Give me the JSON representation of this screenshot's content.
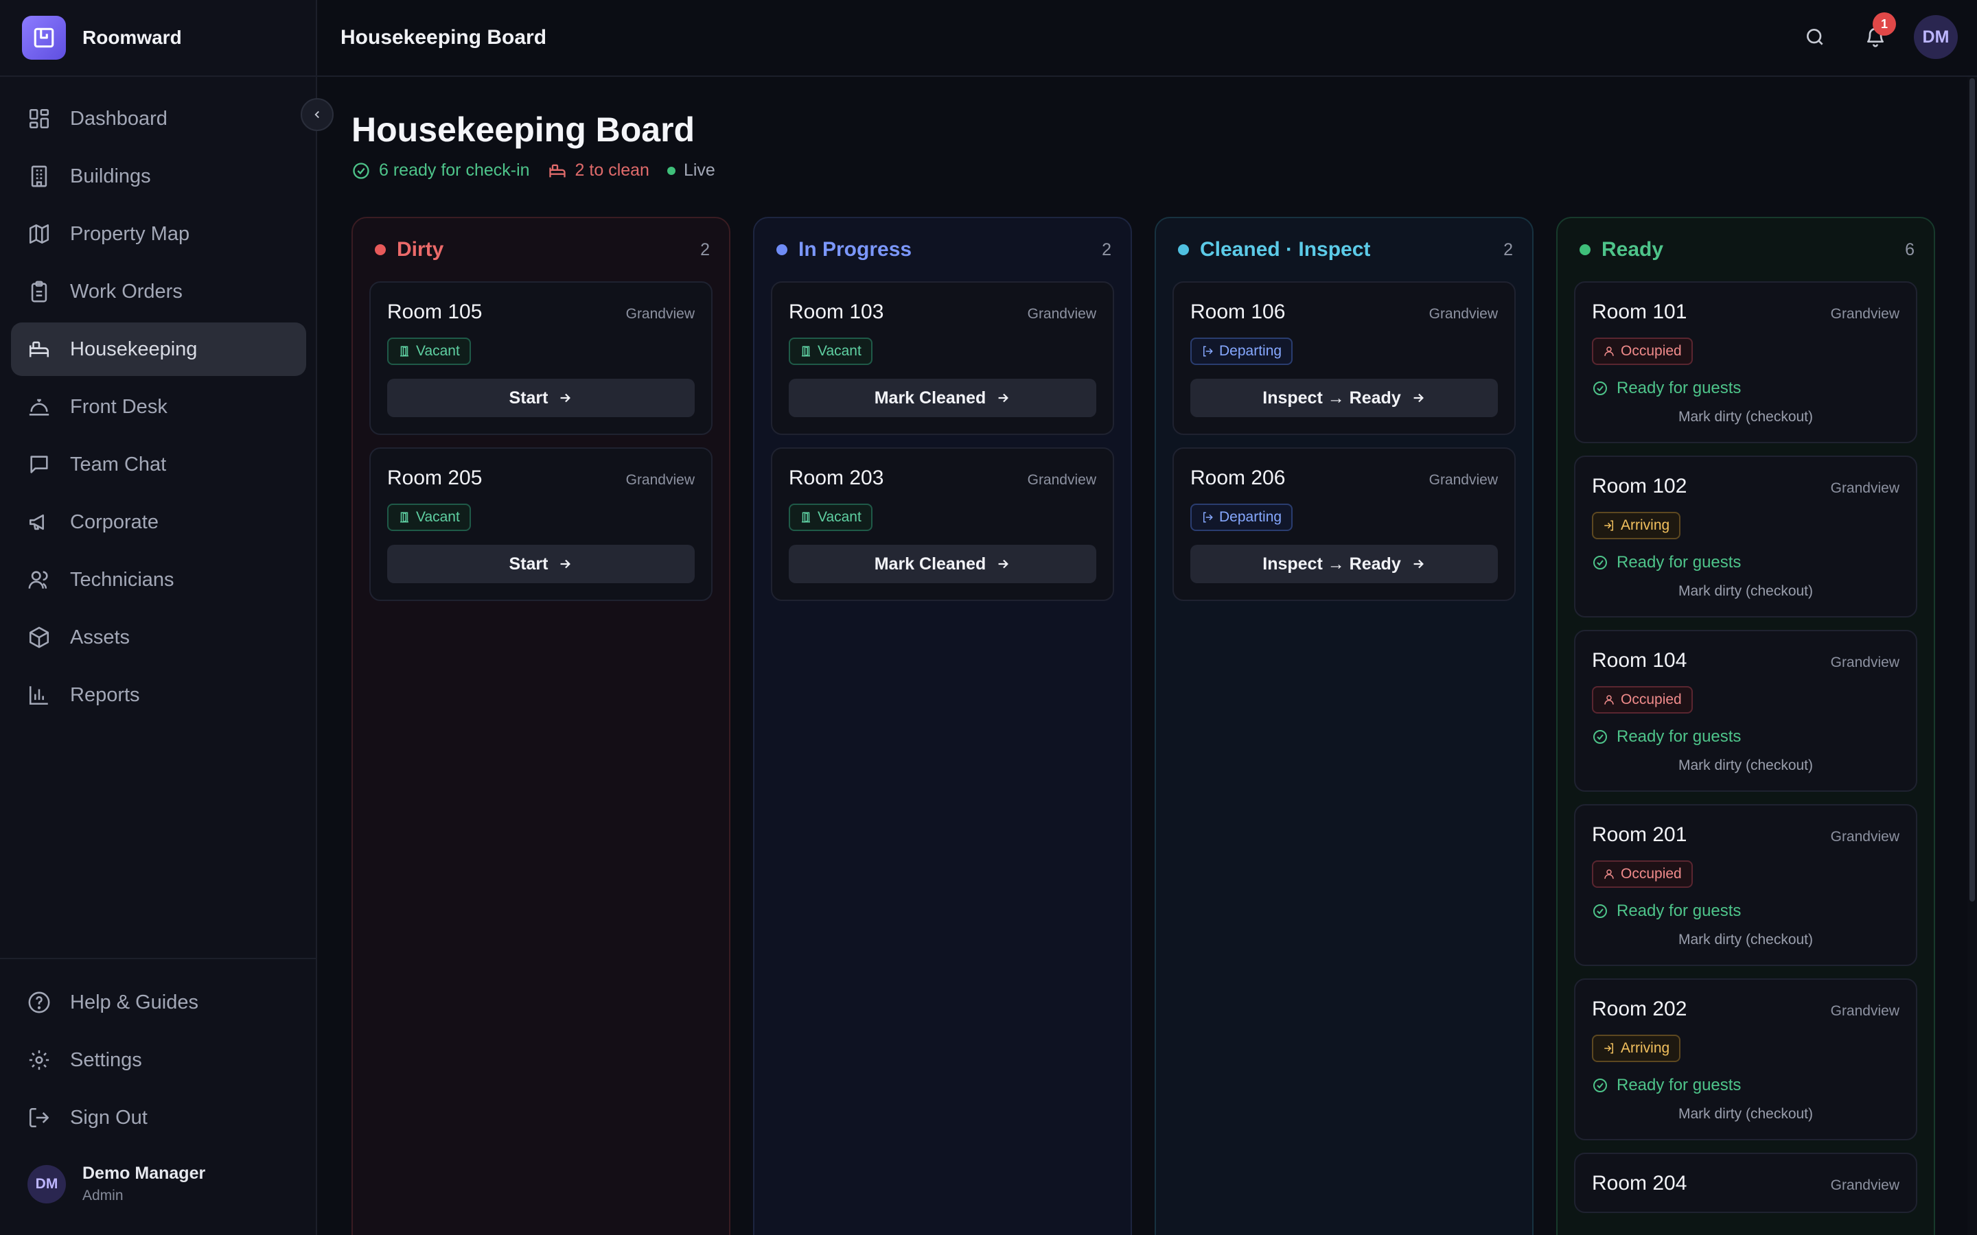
{
  "app": {
    "name": "Roomward"
  },
  "header": {
    "title": "Housekeeping Board",
    "notifications": "1",
    "avatar": "DM"
  },
  "sidebar": {
    "items": [
      {
        "label": "Dashboard"
      },
      {
        "label": "Buildings"
      },
      {
        "label": "Property Map"
      },
      {
        "label": "Work Orders"
      },
      {
        "label": "Housekeeping",
        "active": true
      },
      {
        "label": "Front Desk"
      },
      {
        "label": "Team Chat"
      },
      {
        "label": "Corporate"
      },
      {
        "label": "Technicians"
      },
      {
        "label": "Assets"
      },
      {
        "label": "Reports"
      }
    ],
    "bottom": [
      {
        "label": "Help & Guides"
      },
      {
        "label": "Settings"
      },
      {
        "label": "Sign Out"
      }
    ],
    "user": {
      "initials": "DM",
      "name": "Demo Manager",
      "role": "Admin"
    }
  },
  "page": {
    "title": "Housekeeping Board",
    "ready_summary": "6 ready for check-in",
    "clean_summary": "2 to clean",
    "live": "Live"
  },
  "columns": {
    "dirty": {
      "name": "Dirty",
      "count": "2",
      "color": "#e85a5a",
      "cards": [
        {
          "room": "Room 105",
          "building": "Grandview",
          "status": "Vacant",
          "action": "Start"
        },
        {
          "room": "Room 205",
          "building": "Grandview",
          "status": "Vacant",
          "action": "Start"
        }
      ]
    },
    "progress": {
      "name": "In Progress",
      "count": "2",
      "color": "#6f8cf6",
      "cards": [
        {
          "room": "Room 103",
          "building": "Grandview",
          "status": "Vacant",
          "action": "Mark Cleaned"
        },
        {
          "room": "Room 203",
          "building": "Grandview",
          "status": "Vacant",
          "action": "Mark Cleaned"
        }
      ]
    },
    "cleaned": {
      "name": "Cleaned · Inspect",
      "count": "2",
      "color": "#4fc0e0",
      "cards": [
        {
          "room": "Room 106",
          "building": "Grandview",
          "status": "Departing",
          "action": "Inspect → Ready"
        },
        {
          "room": "Room 206",
          "building": "Grandview",
          "status": "Departing",
          "action": "Inspect → Ready"
        }
      ]
    },
    "ready": {
      "name": "Ready",
      "count": "6",
      "color": "#3fbf7a",
      "cards": [
        {
          "room": "Room 101",
          "building": "Grandview",
          "status": "Occupied",
          "ready": "Ready for guests",
          "action": "Mark dirty (checkout)"
        },
        {
          "room": "Room 102",
          "building": "Grandview",
          "status": "Arriving",
          "ready": "Ready for guests",
          "action": "Mark dirty (checkout)"
        },
        {
          "room": "Room 104",
          "building": "Grandview",
          "status": "Occupied",
          "ready": "Ready for guests",
          "action": "Mark dirty (checkout)"
        },
        {
          "room": "Room 201",
          "building": "Grandview",
          "status": "Occupied",
          "ready": "Ready for guests",
          "action": "Mark dirty (checkout)"
        },
        {
          "room": "Room 202",
          "building": "Grandview",
          "status": "Arriving",
          "ready": "Ready for guests",
          "action": "Mark dirty (checkout)"
        },
        {
          "room": "Room 204",
          "building": "Grandview"
        }
      ]
    }
  }
}
